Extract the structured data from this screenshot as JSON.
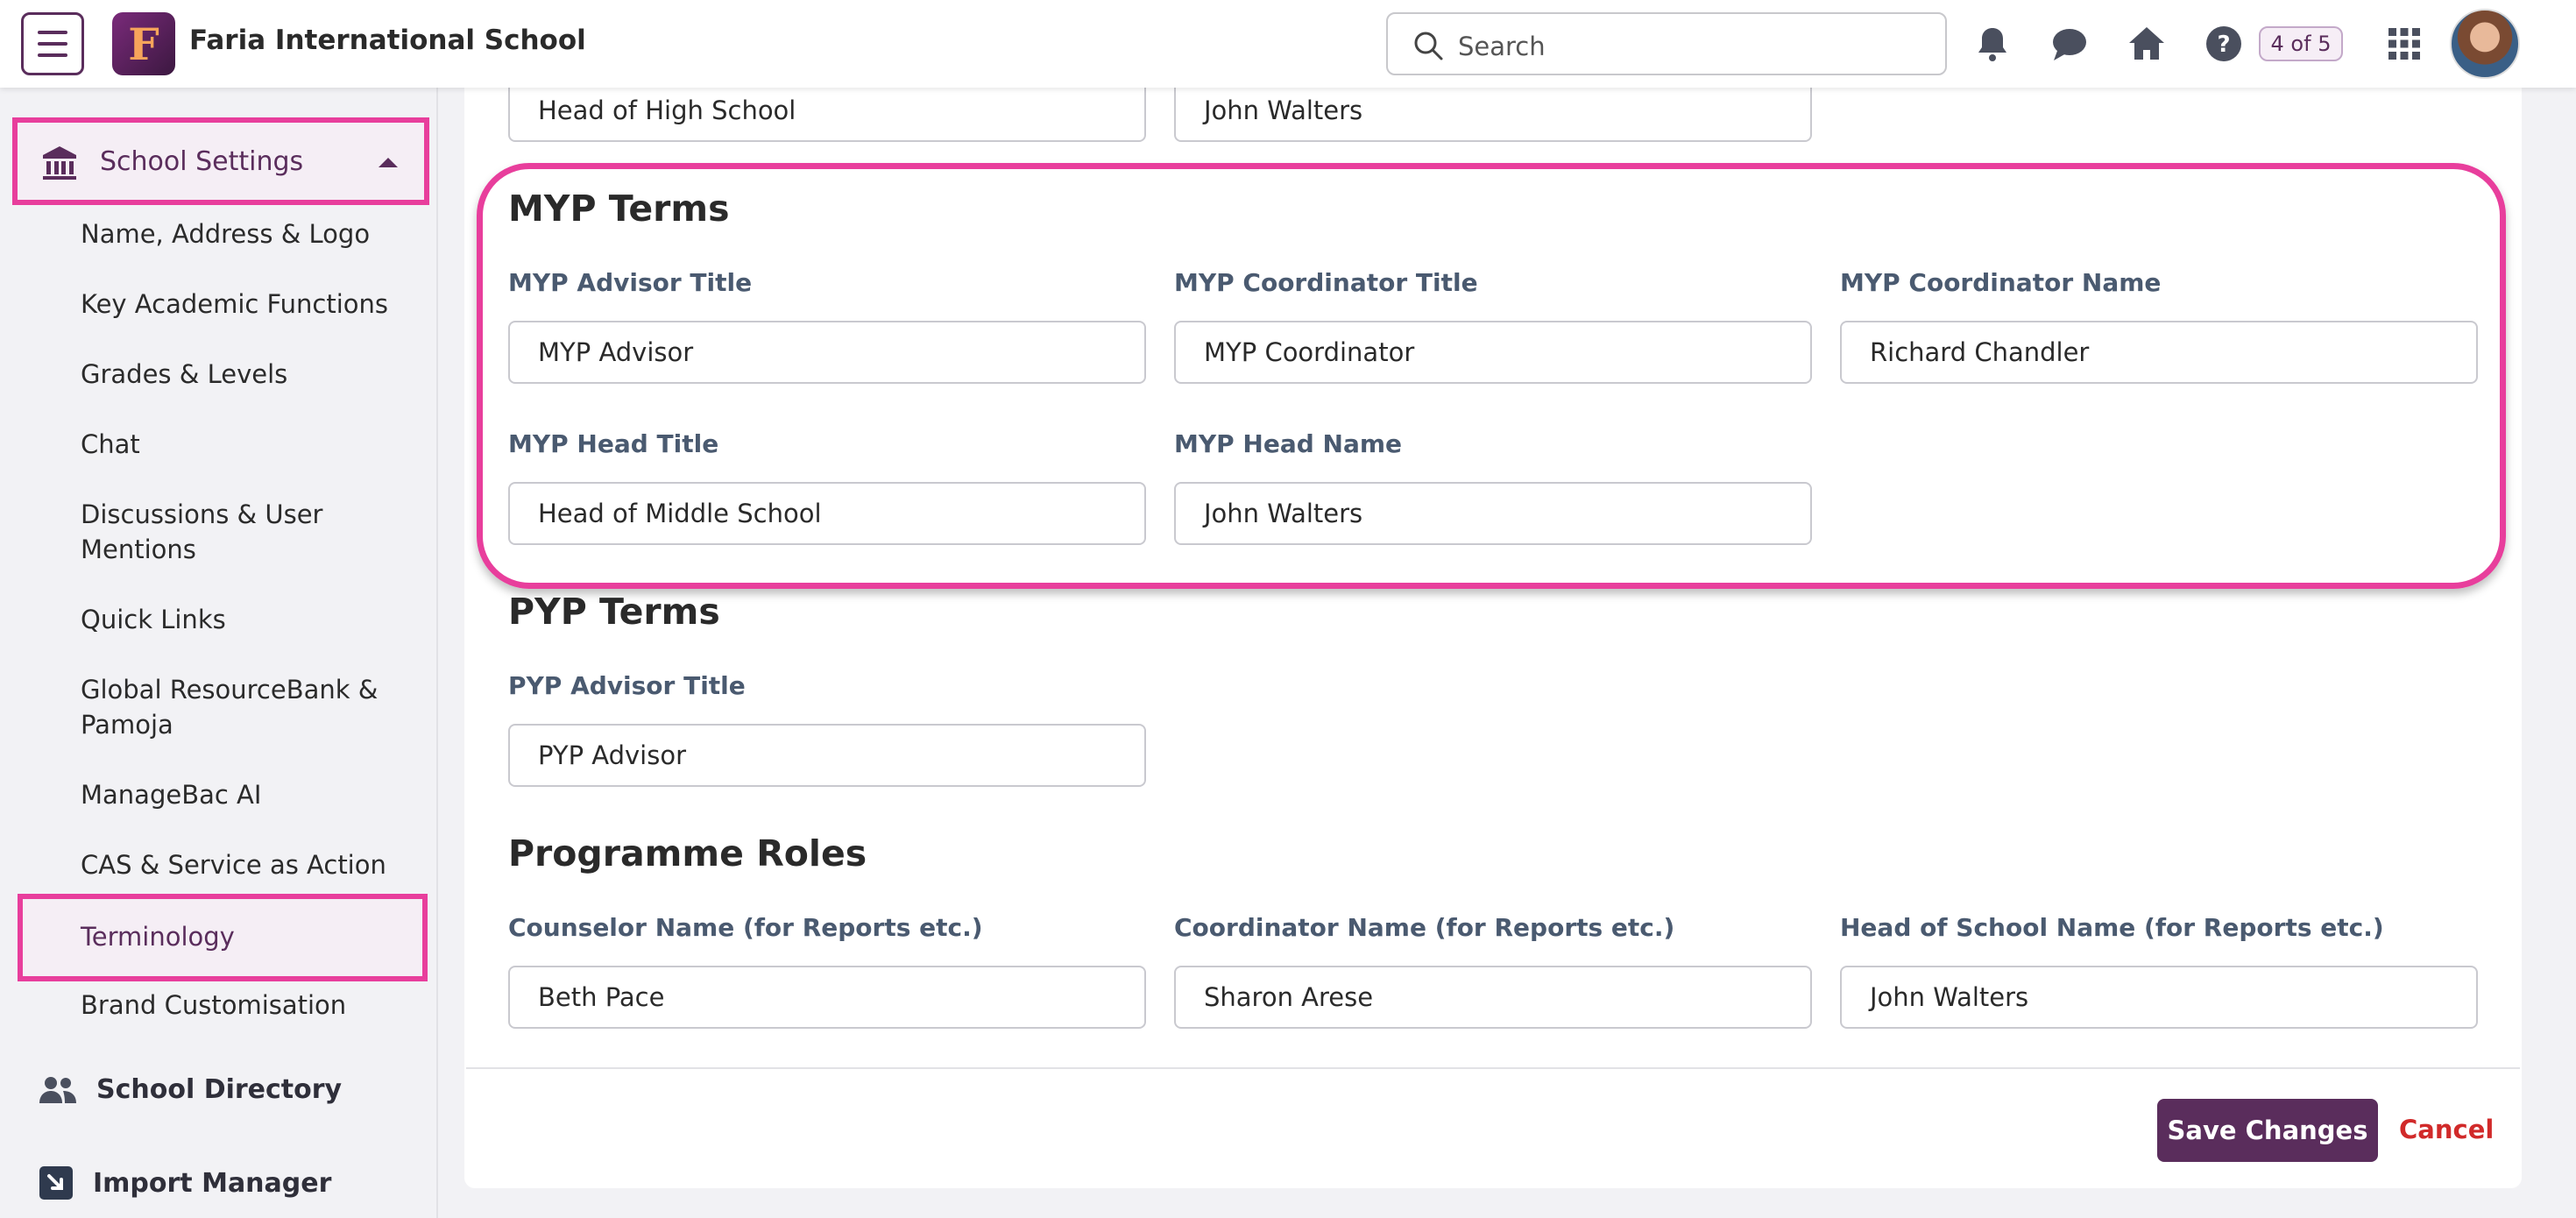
{
  "header": {
    "school_name": "Faria International School",
    "logo_letter": "F",
    "search_placeholder": "Search",
    "pager": "4 of 5"
  },
  "sidebar": {
    "section_title": "School Settings",
    "items": [
      "Name, Address & Logo",
      "Key Academic Functions",
      "Grades & Levels",
      "Chat",
      "Discussions & User Mentions",
      "Quick Links",
      "Global ResourceBank & Pamoja",
      "ManageBac AI",
      "CAS & Service as Action",
      "Terminology",
      "Brand Customisation"
    ],
    "active_item": "Terminology",
    "school_directory": "School Directory",
    "import_manager": "Import Manager"
  },
  "top_row": {
    "fields": [
      {
        "value": "Head of High School"
      },
      {
        "value": "John Walters"
      }
    ]
  },
  "myp": {
    "title": "MYP Terms",
    "fields": [
      {
        "label": "MYP Advisor Title",
        "value": "MYP Advisor"
      },
      {
        "label": "MYP Coordinator Title",
        "value": "MYP Coordinator"
      },
      {
        "label": "MYP Coordinator Name",
        "value": "Richard Chandler"
      },
      {
        "label": "MYP Head Title",
        "value": "Head of Middle School"
      },
      {
        "label": "MYP Head Name",
        "value": "John Walters"
      }
    ]
  },
  "pyp": {
    "title": "PYP Terms",
    "fields": [
      {
        "label": "PYP Advisor Title",
        "value": "PYP Advisor"
      }
    ]
  },
  "roles": {
    "title": "Programme Roles",
    "fields": [
      {
        "label": "Counselor Name (for Reports etc.)",
        "value": "Beth Pace"
      },
      {
        "label": "Coordinator Name (for Reports etc.)",
        "value": "Sharon Arese"
      },
      {
        "label": "Head of School Name (for Reports etc.)",
        "value": "John Walters"
      }
    ]
  },
  "actions": {
    "save": "Save Changes",
    "cancel": "Cancel"
  },
  "colors": {
    "brand": "#5a2d5c",
    "highlight": "#e83e9c",
    "cancel": "#d12a2a"
  }
}
